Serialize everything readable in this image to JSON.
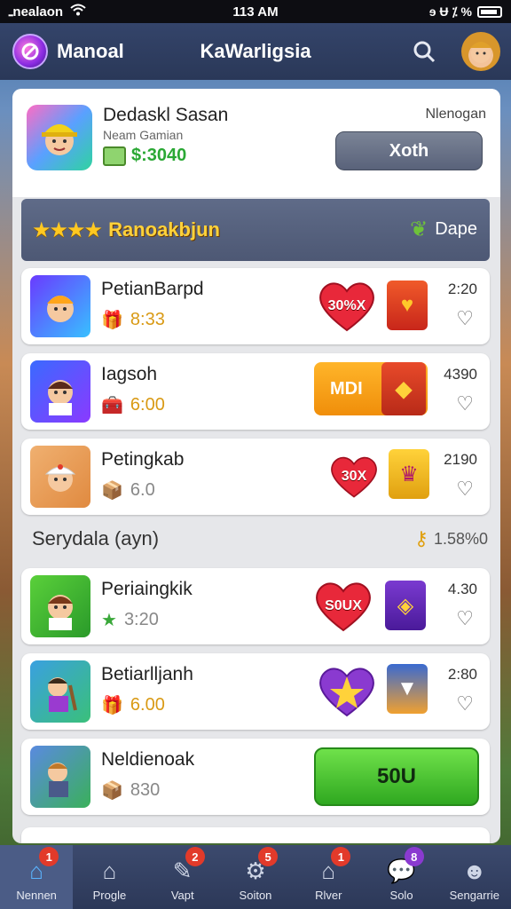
{
  "status_bar": {
    "carrier": "ـnealaon",
    "time": "113 AM",
    "right_icons": "ɘ Ʉ ⁒ %"
  },
  "header": {
    "app_name": "Manoal",
    "title": "KaWarligsia"
  },
  "profile": {
    "name": "Dedaskl Sasan",
    "subtitle": "Neam Gamian",
    "coins": "$:3040",
    "right_label": "Nlenogan",
    "action_label": "Xoth"
  },
  "rank_bar": {
    "stars": "★★★★",
    "title": "Ranoakbjun",
    "right_label": "Dape"
  },
  "rows_top": [
    {
      "name": "PetianBarpd",
      "score": "8:33",
      "badge1": "30%X",
      "time": "2:20"
    },
    {
      "name": "Iagsoh",
      "score": "6:00",
      "badge1": "MDI",
      "time": "4390"
    },
    {
      "name": "Petingkab",
      "score": "6.0",
      "badge1": "30X",
      "time": "2190"
    }
  ],
  "section": {
    "title": "Serydala (ayn)",
    "right_label": "1.58%0"
  },
  "rows_bottom": [
    {
      "name": "Periaingkik",
      "score": "3:20",
      "badge1": "S0UX",
      "time": "4.30"
    },
    {
      "name": "Betiarlljanh",
      "score": "6.00",
      "time": "2:80"
    },
    {
      "name": "Neldienoak",
      "score": "830",
      "button_label": "50U"
    }
  ],
  "bottom_nav": [
    {
      "label": "Nennen",
      "badge": "1"
    },
    {
      "label": "Progle",
      "badge": ""
    },
    {
      "label": "Vapt",
      "badge": "2"
    },
    {
      "label": "Soiton",
      "badge": "5"
    },
    {
      "label": "Rlver",
      "badge": "1"
    },
    {
      "label": "Solo",
      "badge": "8"
    },
    {
      "label": "Sengarrie",
      "badge": ""
    }
  ],
  "colors": {
    "accent_blue": "#5ab4ff",
    "badge_red": "#e23a2a",
    "coins_green": "#2aa834",
    "rank_gold": "#ffd23a"
  }
}
